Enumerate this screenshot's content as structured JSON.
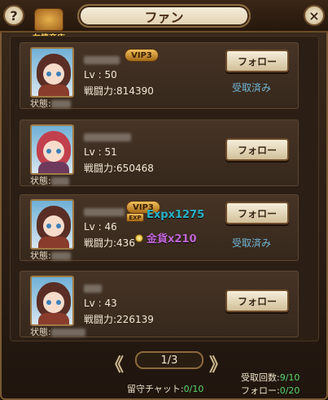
{
  "header": {
    "title": "ファン",
    "help_label": "?",
    "close_label": "×",
    "shop_label": "友情商店"
  },
  "fans": [
    {
      "vip": "VIP3",
      "level": "Lv : 50",
      "power": "戦闘力:814390",
      "follow_label": "フォロー",
      "received": "受取済み",
      "status_label": "状態:",
      "hair": "#5a2e25"
    },
    {
      "vip": "",
      "level": "Lv : 51",
      "power": "戦闘力:650468",
      "follow_label": "フォロー",
      "received": "",
      "status_label": "状態:",
      "hair": "#c2404e"
    },
    {
      "vip": "VIP3",
      "level": "Lv : 46",
      "power": "戦闘力:436",
      "follow_label": "フォロー",
      "received": "受取済み",
      "status_label": "状態:",
      "hair": "#5a2e25"
    },
    {
      "vip": "",
      "level": "Lv : 43",
      "power": "戦闘力:226139",
      "follow_label": "フォロー",
      "received": "",
      "status_label": "状態:",
      "hair": "#5a2e25"
    }
  ],
  "reward_popup": {
    "exp": "Expx1275",
    "gold": "金貨x210",
    "exp_tag": "EXP"
  },
  "pager": {
    "prev": "《",
    "next": "》",
    "page": "1/3"
  },
  "footer": {
    "chat_label": "留守チャット:",
    "chat_value": "0/10",
    "receive_label": "受取回数:",
    "receive_value": "9/10",
    "follow_label": "フォロー:",
    "follow_value": "0/20"
  }
}
